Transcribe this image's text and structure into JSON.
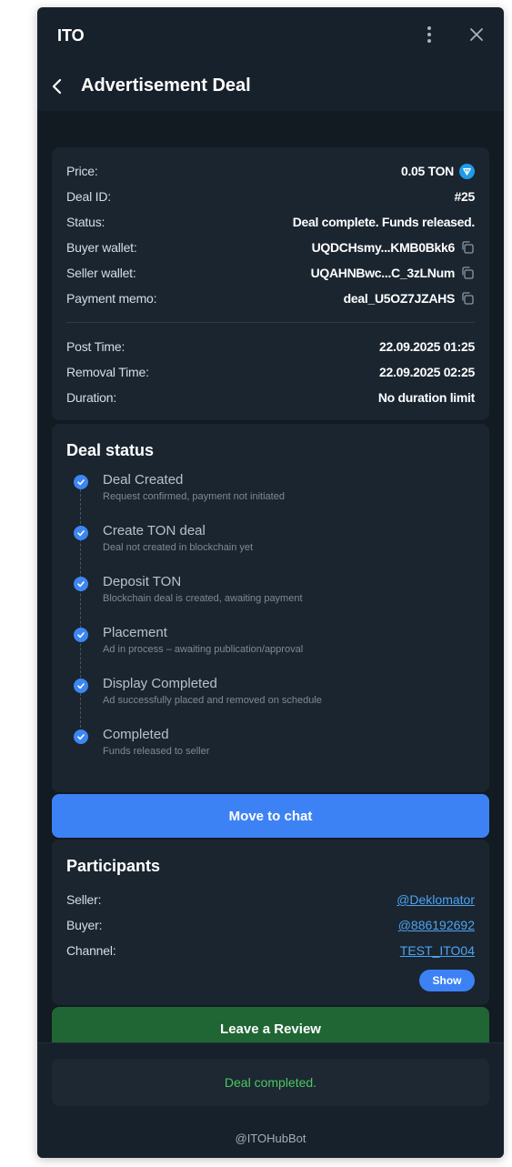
{
  "app": {
    "title": "ITO"
  },
  "page": {
    "title": "Advertisement Deal"
  },
  "deal": {
    "price_label": "Price:",
    "price_value": "0.05 TON",
    "id_label": "Deal ID:",
    "id_value": "#25",
    "status_label": "Status:",
    "status_value": "Deal complete. Funds released.",
    "buyer_wallet_label": "Buyer wallet:",
    "buyer_wallet_value": "UQDCHsmy...KMB0Bkk6",
    "seller_wallet_label": "Seller wallet:",
    "seller_wallet_value": "UQAHNBwc...C_3zLNum",
    "memo_label": "Payment memo:",
    "memo_value": "deal_U5OZ7JZAHS",
    "post_time_label": "Post Time:",
    "post_time_value": "22.09.2025 01:25",
    "removal_time_label": "Removal Time:",
    "removal_time_value": "22.09.2025 02:25",
    "duration_label": "Duration:",
    "duration_value": "No duration limit"
  },
  "deal_status": {
    "title": "Deal status",
    "steps": [
      {
        "title": "Deal Created",
        "subtitle": "Request confirmed, payment not initiated"
      },
      {
        "title": "Create TON deal",
        "subtitle": "Deal not created in blockchain yet"
      },
      {
        "title": "Deposit TON",
        "subtitle": "Blockchain deal is created, awaiting payment"
      },
      {
        "title": "Placement",
        "subtitle": "Ad in process – awaiting publication/approval"
      },
      {
        "title": "Display Completed",
        "subtitle": "Ad successfully placed and removed on schedule"
      },
      {
        "title": "Completed",
        "subtitle": "Funds released to seller"
      }
    ]
  },
  "buttons": {
    "chat": "Move to chat",
    "show": "Show",
    "review": "Leave a Review"
  },
  "participants": {
    "title": "Participants",
    "seller_label": "Seller:",
    "seller_value": "@Deklomator",
    "buyer_label": "Buyer:",
    "buyer_value": "@886192692",
    "channel_label": "Channel:",
    "channel_value": "TEST_ITO04"
  },
  "status_message": "Deal completed.",
  "footer": "@ITOHubBot",
  "colors": {
    "accent": "#3d82f5",
    "review": "#1f6634",
    "success_text": "#4cc760",
    "link": "#4ea3f0"
  },
  "icons": {
    "menu": "more-vertical-icon",
    "close": "close-icon",
    "back": "chevron-left-icon",
    "copy": "copy-icon",
    "ton": "ton-icon",
    "check": "check-icon"
  }
}
